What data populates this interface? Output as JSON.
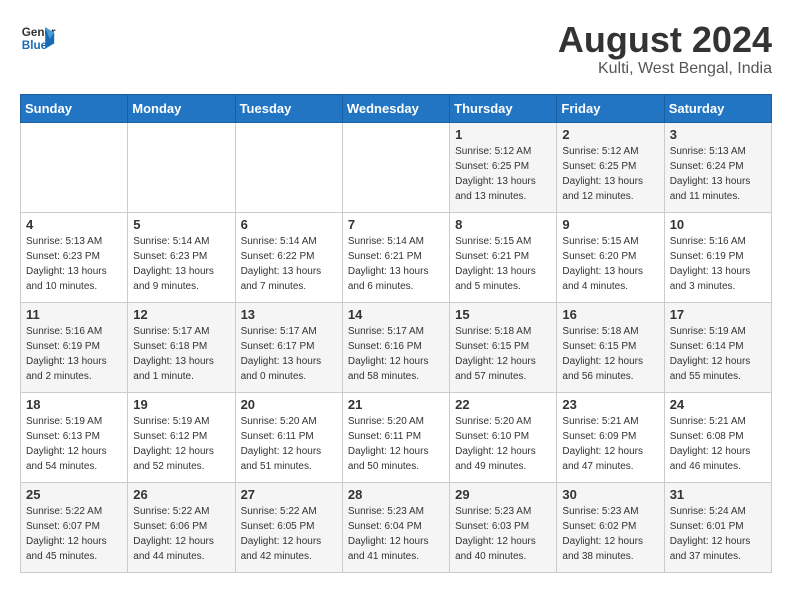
{
  "header": {
    "logo_general": "General",
    "logo_blue": "Blue",
    "month_year": "August 2024",
    "location": "Kulti, West Bengal, India"
  },
  "weekdays": [
    "Sunday",
    "Monday",
    "Tuesday",
    "Wednesday",
    "Thursday",
    "Friday",
    "Saturday"
  ],
  "weeks": [
    [
      {
        "day": "",
        "info": ""
      },
      {
        "day": "",
        "info": ""
      },
      {
        "day": "",
        "info": ""
      },
      {
        "day": "",
        "info": ""
      },
      {
        "day": "1",
        "info": "Sunrise: 5:12 AM\nSunset: 6:25 PM\nDaylight: 13 hours\nand 13 minutes."
      },
      {
        "day": "2",
        "info": "Sunrise: 5:12 AM\nSunset: 6:25 PM\nDaylight: 13 hours\nand 12 minutes."
      },
      {
        "day": "3",
        "info": "Sunrise: 5:13 AM\nSunset: 6:24 PM\nDaylight: 13 hours\nand 11 minutes."
      }
    ],
    [
      {
        "day": "4",
        "info": "Sunrise: 5:13 AM\nSunset: 6:23 PM\nDaylight: 13 hours\nand 10 minutes."
      },
      {
        "day": "5",
        "info": "Sunrise: 5:14 AM\nSunset: 6:23 PM\nDaylight: 13 hours\nand 9 minutes."
      },
      {
        "day": "6",
        "info": "Sunrise: 5:14 AM\nSunset: 6:22 PM\nDaylight: 13 hours\nand 7 minutes."
      },
      {
        "day": "7",
        "info": "Sunrise: 5:14 AM\nSunset: 6:21 PM\nDaylight: 13 hours\nand 6 minutes."
      },
      {
        "day": "8",
        "info": "Sunrise: 5:15 AM\nSunset: 6:21 PM\nDaylight: 13 hours\nand 5 minutes."
      },
      {
        "day": "9",
        "info": "Sunrise: 5:15 AM\nSunset: 6:20 PM\nDaylight: 13 hours\nand 4 minutes."
      },
      {
        "day": "10",
        "info": "Sunrise: 5:16 AM\nSunset: 6:19 PM\nDaylight: 13 hours\nand 3 minutes."
      }
    ],
    [
      {
        "day": "11",
        "info": "Sunrise: 5:16 AM\nSunset: 6:19 PM\nDaylight: 13 hours\nand 2 minutes."
      },
      {
        "day": "12",
        "info": "Sunrise: 5:17 AM\nSunset: 6:18 PM\nDaylight: 13 hours\nand 1 minute."
      },
      {
        "day": "13",
        "info": "Sunrise: 5:17 AM\nSunset: 6:17 PM\nDaylight: 13 hours\nand 0 minutes."
      },
      {
        "day": "14",
        "info": "Sunrise: 5:17 AM\nSunset: 6:16 PM\nDaylight: 12 hours\nand 58 minutes."
      },
      {
        "day": "15",
        "info": "Sunrise: 5:18 AM\nSunset: 6:15 PM\nDaylight: 12 hours\nand 57 minutes."
      },
      {
        "day": "16",
        "info": "Sunrise: 5:18 AM\nSunset: 6:15 PM\nDaylight: 12 hours\nand 56 minutes."
      },
      {
        "day": "17",
        "info": "Sunrise: 5:19 AM\nSunset: 6:14 PM\nDaylight: 12 hours\nand 55 minutes."
      }
    ],
    [
      {
        "day": "18",
        "info": "Sunrise: 5:19 AM\nSunset: 6:13 PM\nDaylight: 12 hours\nand 54 minutes."
      },
      {
        "day": "19",
        "info": "Sunrise: 5:19 AM\nSunset: 6:12 PM\nDaylight: 12 hours\nand 52 minutes."
      },
      {
        "day": "20",
        "info": "Sunrise: 5:20 AM\nSunset: 6:11 PM\nDaylight: 12 hours\nand 51 minutes."
      },
      {
        "day": "21",
        "info": "Sunrise: 5:20 AM\nSunset: 6:11 PM\nDaylight: 12 hours\nand 50 minutes."
      },
      {
        "day": "22",
        "info": "Sunrise: 5:20 AM\nSunset: 6:10 PM\nDaylight: 12 hours\nand 49 minutes."
      },
      {
        "day": "23",
        "info": "Sunrise: 5:21 AM\nSunset: 6:09 PM\nDaylight: 12 hours\nand 47 minutes."
      },
      {
        "day": "24",
        "info": "Sunrise: 5:21 AM\nSunset: 6:08 PM\nDaylight: 12 hours\nand 46 minutes."
      }
    ],
    [
      {
        "day": "25",
        "info": "Sunrise: 5:22 AM\nSunset: 6:07 PM\nDaylight: 12 hours\nand 45 minutes."
      },
      {
        "day": "26",
        "info": "Sunrise: 5:22 AM\nSunset: 6:06 PM\nDaylight: 12 hours\nand 44 minutes."
      },
      {
        "day": "27",
        "info": "Sunrise: 5:22 AM\nSunset: 6:05 PM\nDaylight: 12 hours\nand 42 minutes."
      },
      {
        "day": "28",
        "info": "Sunrise: 5:23 AM\nSunset: 6:04 PM\nDaylight: 12 hours\nand 41 minutes."
      },
      {
        "day": "29",
        "info": "Sunrise: 5:23 AM\nSunset: 6:03 PM\nDaylight: 12 hours\nand 40 minutes."
      },
      {
        "day": "30",
        "info": "Sunrise: 5:23 AM\nSunset: 6:02 PM\nDaylight: 12 hours\nand 38 minutes."
      },
      {
        "day": "31",
        "info": "Sunrise: 5:24 AM\nSunset: 6:01 PM\nDaylight: 12 hours\nand 37 minutes."
      }
    ]
  ]
}
